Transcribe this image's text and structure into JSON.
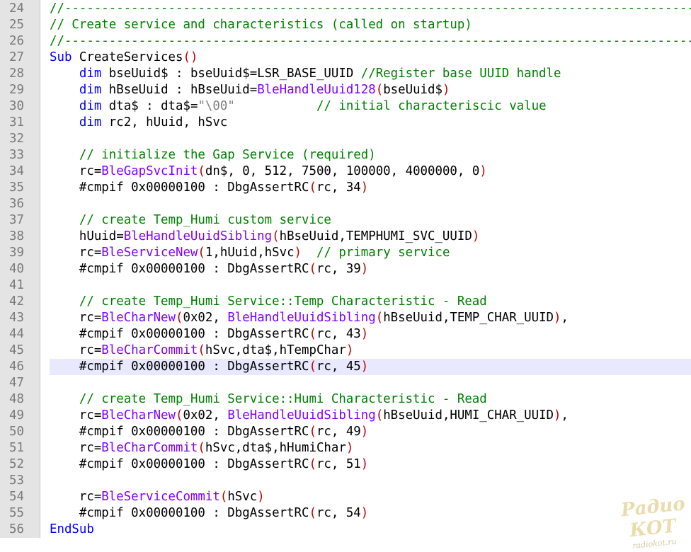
{
  "editor": {
    "current_line": 46,
    "lines": [
      {
        "n": "24",
        "tokens": [
          {
            "t": "//-------------------------------------------------------------------------------------------------",
            "c": "cmt"
          }
        ]
      },
      {
        "n": "25",
        "tokens": [
          {
            "t": "// Create service and characteristics (called on startup)",
            "c": "cmt"
          }
        ]
      },
      {
        "n": "26",
        "tokens": [
          {
            "t": "//-------------------------------------------------------------------------------------------------",
            "c": "cmt"
          }
        ]
      },
      {
        "n": "27",
        "tokens": [
          {
            "t": "Sub",
            "c": "kw"
          },
          {
            "t": " CreateServices",
            "c": "plain"
          },
          {
            "t": "()",
            "c": "paren"
          }
        ]
      },
      {
        "n": "28",
        "tokens": [
          {
            "t": "    ",
            "c": "plain"
          },
          {
            "t": "dim",
            "c": "kw"
          },
          {
            "t": " bseUuid$ : bseUuid$=LSR_BASE_UUID ",
            "c": "plain"
          },
          {
            "t": "//Register base UUID handle",
            "c": "cmt"
          }
        ]
      },
      {
        "n": "29",
        "tokens": [
          {
            "t": "    ",
            "c": "plain"
          },
          {
            "t": "dim",
            "c": "kw"
          },
          {
            "t": " hBseUuid : hBseUuid=",
            "c": "plain"
          },
          {
            "t": "BleHandleUuid128",
            "c": "fn"
          },
          {
            "t": "(",
            "c": "paren"
          },
          {
            "t": "bseUuid$",
            "c": "plain"
          },
          {
            "t": ")",
            "c": "paren"
          }
        ]
      },
      {
        "n": "30",
        "tokens": [
          {
            "t": "    ",
            "c": "plain"
          },
          {
            "t": "dim",
            "c": "kw"
          },
          {
            "t": " dta$ : dta$=",
            "c": "plain"
          },
          {
            "t": "\"\\00\"",
            "c": "str"
          },
          {
            "t": "           ",
            "c": "plain"
          },
          {
            "t": "// initial characteriscic value",
            "c": "cmt"
          }
        ]
      },
      {
        "n": "31",
        "tokens": [
          {
            "t": "    ",
            "c": "plain"
          },
          {
            "t": "dim",
            "c": "kw"
          },
          {
            "t": " rc2, hUuid, hSvc",
            "c": "plain"
          }
        ]
      },
      {
        "n": "32",
        "tokens": []
      },
      {
        "n": "33",
        "tokens": [
          {
            "t": "    ",
            "c": "plain"
          },
          {
            "t": "// initialize the Gap Service (required)",
            "c": "cmt"
          }
        ]
      },
      {
        "n": "34",
        "tokens": [
          {
            "t": "    rc=",
            "c": "plain"
          },
          {
            "t": "BleGapSvcInit",
            "c": "fn"
          },
          {
            "t": "(",
            "c": "paren"
          },
          {
            "t": "dn$, 0, 512, 7500, 100000, 4000000, 0",
            "c": "plain"
          },
          {
            "t": ")",
            "c": "paren"
          }
        ]
      },
      {
        "n": "35",
        "tokens": [
          {
            "t": "    #cmpif 0x00000100 : DbgAssertRC",
            "c": "plain"
          },
          {
            "t": "(",
            "c": "paren"
          },
          {
            "t": "rc, 34",
            "c": "plain"
          },
          {
            "t": ")",
            "c": "paren"
          }
        ]
      },
      {
        "n": "36",
        "tokens": []
      },
      {
        "n": "37",
        "tokens": [
          {
            "t": "    ",
            "c": "plain"
          },
          {
            "t": "// create Temp_Humi custom service",
            "c": "cmt"
          }
        ]
      },
      {
        "n": "38",
        "tokens": [
          {
            "t": "    hUuid=",
            "c": "plain"
          },
          {
            "t": "BleHandleUuidSibling",
            "c": "fn"
          },
          {
            "t": "(",
            "c": "paren"
          },
          {
            "t": "hBseUuid,TEMPHUMI_SVC_UUID",
            "c": "plain"
          },
          {
            "t": ")",
            "c": "paren"
          }
        ]
      },
      {
        "n": "39",
        "tokens": [
          {
            "t": "    rc=",
            "c": "plain"
          },
          {
            "t": "BleServiceNew",
            "c": "fn"
          },
          {
            "t": "(",
            "c": "paren"
          },
          {
            "t": "1,hUuid,hSvc",
            "c": "plain"
          },
          {
            "t": ")",
            "c": "paren"
          },
          {
            "t": "  ",
            "c": "plain"
          },
          {
            "t": "// primary service",
            "c": "cmt"
          }
        ]
      },
      {
        "n": "40",
        "tokens": [
          {
            "t": "    #cmpif 0x00000100 : DbgAssertRC",
            "c": "plain"
          },
          {
            "t": "(",
            "c": "paren"
          },
          {
            "t": "rc, 39",
            "c": "plain"
          },
          {
            "t": ")",
            "c": "paren"
          }
        ]
      },
      {
        "n": "41",
        "tokens": []
      },
      {
        "n": "42",
        "tokens": [
          {
            "t": "    ",
            "c": "plain"
          },
          {
            "t": "// create Temp_Humi Service::Temp Characteristic - Read",
            "c": "cmt"
          }
        ]
      },
      {
        "n": "43",
        "tokens": [
          {
            "t": "    rc=",
            "c": "plain"
          },
          {
            "t": "BleCharNew",
            "c": "fn"
          },
          {
            "t": "(",
            "c": "paren"
          },
          {
            "t": "0x02, ",
            "c": "plain"
          },
          {
            "t": "BleHandleUuidSibling",
            "c": "fn"
          },
          {
            "t": "(",
            "c": "paren"
          },
          {
            "t": "hBseUuid,TEMP_CHAR_UUID",
            "c": "plain"
          },
          {
            "t": ")",
            "c": "paren"
          },
          {
            "t": ",",
            "c": "plain"
          }
        ]
      },
      {
        "n": "44",
        "tokens": [
          {
            "t": "    #cmpif 0x00000100 : DbgAssertRC",
            "c": "plain"
          },
          {
            "t": "(",
            "c": "paren"
          },
          {
            "t": "rc, 43",
            "c": "plain"
          },
          {
            "t": ")",
            "c": "paren"
          }
        ]
      },
      {
        "n": "45",
        "tokens": [
          {
            "t": "    rc=",
            "c": "plain"
          },
          {
            "t": "BleCharCommit",
            "c": "fn"
          },
          {
            "t": "(",
            "c": "paren"
          },
          {
            "t": "hSvc,dta$,hTempChar",
            "c": "plain"
          },
          {
            "t": ")",
            "c": "paren"
          }
        ]
      },
      {
        "n": "46",
        "tokens": [
          {
            "t": "    #cmpif 0x00000100 : DbgAssertRC",
            "c": "plain"
          },
          {
            "t": "(",
            "c": "paren"
          },
          {
            "t": "rc, 45",
            "c": "plain"
          },
          {
            "t": ")",
            "c": "paren"
          }
        ]
      },
      {
        "n": "47",
        "tokens": []
      },
      {
        "n": "48",
        "tokens": [
          {
            "t": "    ",
            "c": "plain"
          },
          {
            "t": "// create Temp_Humi Service::Humi Characteristic - Read",
            "c": "cmt"
          }
        ]
      },
      {
        "n": "49",
        "tokens": [
          {
            "t": "    rc=",
            "c": "plain"
          },
          {
            "t": "BleCharNew",
            "c": "fn"
          },
          {
            "t": "(",
            "c": "paren"
          },
          {
            "t": "0x02, ",
            "c": "plain"
          },
          {
            "t": "BleHandleUuidSibling",
            "c": "fn"
          },
          {
            "t": "(",
            "c": "paren"
          },
          {
            "t": "hBseUuid,HUMI_CHAR_UUID",
            "c": "plain"
          },
          {
            "t": ")",
            "c": "paren"
          },
          {
            "t": ",",
            "c": "plain"
          }
        ]
      },
      {
        "n": "50",
        "tokens": [
          {
            "t": "    #cmpif 0x00000100 : DbgAssertRC",
            "c": "plain"
          },
          {
            "t": "(",
            "c": "paren"
          },
          {
            "t": "rc, 49",
            "c": "plain"
          },
          {
            "t": ")",
            "c": "paren"
          }
        ]
      },
      {
        "n": "51",
        "tokens": [
          {
            "t": "    rc=",
            "c": "plain"
          },
          {
            "t": "BleCharCommit",
            "c": "fn"
          },
          {
            "t": "(",
            "c": "paren"
          },
          {
            "t": "hSvc,dta$,hHumiChar",
            "c": "plain"
          },
          {
            "t": ")",
            "c": "paren"
          }
        ]
      },
      {
        "n": "52",
        "tokens": [
          {
            "t": "    #cmpif 0x00000100 : DbgAssertRC",
            "c": "plain"
          },
          {
            "t": "(",
            "c": "paren"
          },
          {
            "t": "rc, 51",
            "c": "plain"
          },
          {
            "t": ")",
            "c": "paren"
          }
        ]
      },
      {
        "n": "53",
        "tokens": []
      },
      {
        "n": "54",
        "tokens": [
          {
            "t": "    rc=",
            "c": "plain"
          },
          {
            "t": "BleServiceCommit",
            "c": "fn"
          },
          {
            "t": "(",
            "c": "paren"
          },
          {
            "t": "hSvc",
            "c": "plain"
          },
          {
            "t": ")",
            "c": "paren"
          }
        ]
      },
      {
        "n": "55",
        "tokens": [
          {
            "t": "    #cmpif 0x00000100 : DbgAssertRC",
            "c": "plain"
          },
          {
            "t": "(",
            "c": "paren"
          },
          {
            "t": "rc, 54",
            "c": "plain"
          },
          {
            "t": ")",
            "c": "paren"
          }
        ]
      },
      {
        "n": "56",
        "tokens": [
          {
            "t": "EndSub",
            "c": "kw"
          }
        ]
      }
    ]
  },
  "watermark": {
    "main": "Радио КОТ",
    "sub": "radiokot.ru"
  },
  "colors": {
    "comment": "#008000",
    "keyword": "#0000ff",
    "function": "#8000ff",
    "paren": "#c00000",
    "string": "#808080",
    "gutter_bg": "#e4e4e4",
    "current_line_bg": "#e8e8ff"
  }
}
